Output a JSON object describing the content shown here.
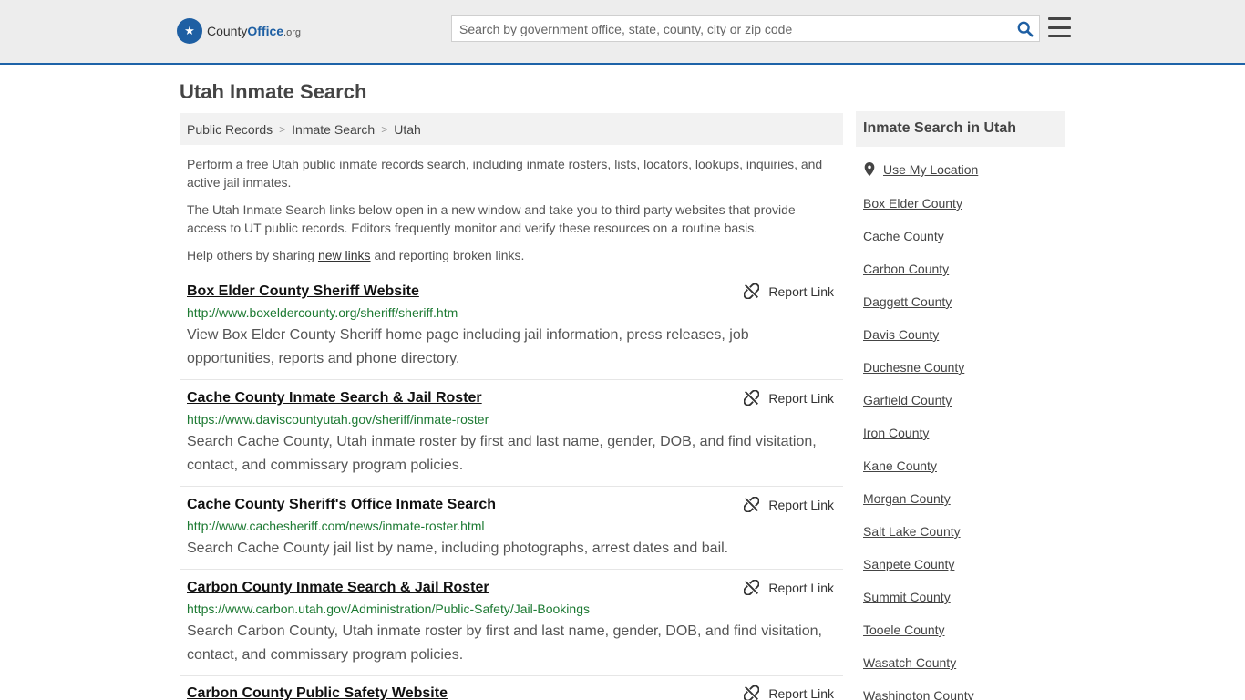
{
  "header": {
    "logo_prefix": "County",
    "logo_brand": "Office",
    "logo_tld": ".org",
    "search_placeholder": "Search by government office, state, county, city or zip code",
    "search_icon": "search-icon",
    "menu_icon": "hamburger-menu-icon",
    "accent_color": "#1e63a8"
  },
  "page": {
    "title": "Utah Inmate Search"
  },
  "breadcrumb": [
    "Public Records",
    "Inmate Search",
    "Utah"
  ],
  "intro": {
    "p1": "Perform a free Utah public inmate records search, including inmate rosters, lists, locators, lookups, inquiries, and active jail inmates.",
    "p2": "The Utah Inmate Search links below open in a new window and take you to third party websites that provide access to UT public records. Editors frequently monitor and verify these resources on a routine basis.",
    "p3_before": "Help others by sharing ",
    "p3_link": "new links",
    "p3_after": " and reporting broken links."
  },
  "report_label": "Report Link",
  "results": [
    {
      "title": "Box Elder County Sheriff Website",
      "url": "http://www.boxeldercounty.org/sheriff/sheriff.htm",
      "desc": "View Box Elder County Sheriff home page including jail information, press releases, job opportunities, reports and phone directory."
    },
    {
      "title": "Cache County Inmate Search & Jail Roster",
      "url": "https://www.daviscountyutah.gov/sheriff/inmate-roster",
      "desc": "Search Cache County, Utah inmate roster by first and last name, gender, DOB, and find visitation, contact, and commissary program policies."
    },
    {
      "title": "Cache County Sheriff's Office Inmate Search",
      "url": "http://www.cachesheriff.com/news/inmate-roster.html",
      "desc": "Search Cache County jail list by name, including photographs, arrest dates and bail."
    },
    {
      "title": "Carbon County Inmate Search & Jail Roster",
      "url": "https://www.carbon.utah.gov/Administration/Public-Safety/Jail-Bookings",
      "desc": "Search Carbon County, Utah inmate roster by first and last name, gender, DOB, and find visitation, contact, and commissary program policies."
    },
    {
      "title": "Carbon County Public Safety Website",
      "url": "",
      "desc": ""
    }
  ],
  "sidebar": {
    "title": "Inmate Search in Utah",
    "use_location": "Use My Location",
    "counties": [
      "Box Elder County",
      "Cache County",
      "Carbon County",
      "Daggett County",
      "Davis County",
      "Duchesne County",
      "Garfield County",
      "Iron County",
      "Kane County",
      "Morgan County",
      "Salt Lake County",
      "Sanpete County",
      "Summit County",
      "Tooele County",
      "Wasatch County",
      "Washington County"
    ]
  }
}
